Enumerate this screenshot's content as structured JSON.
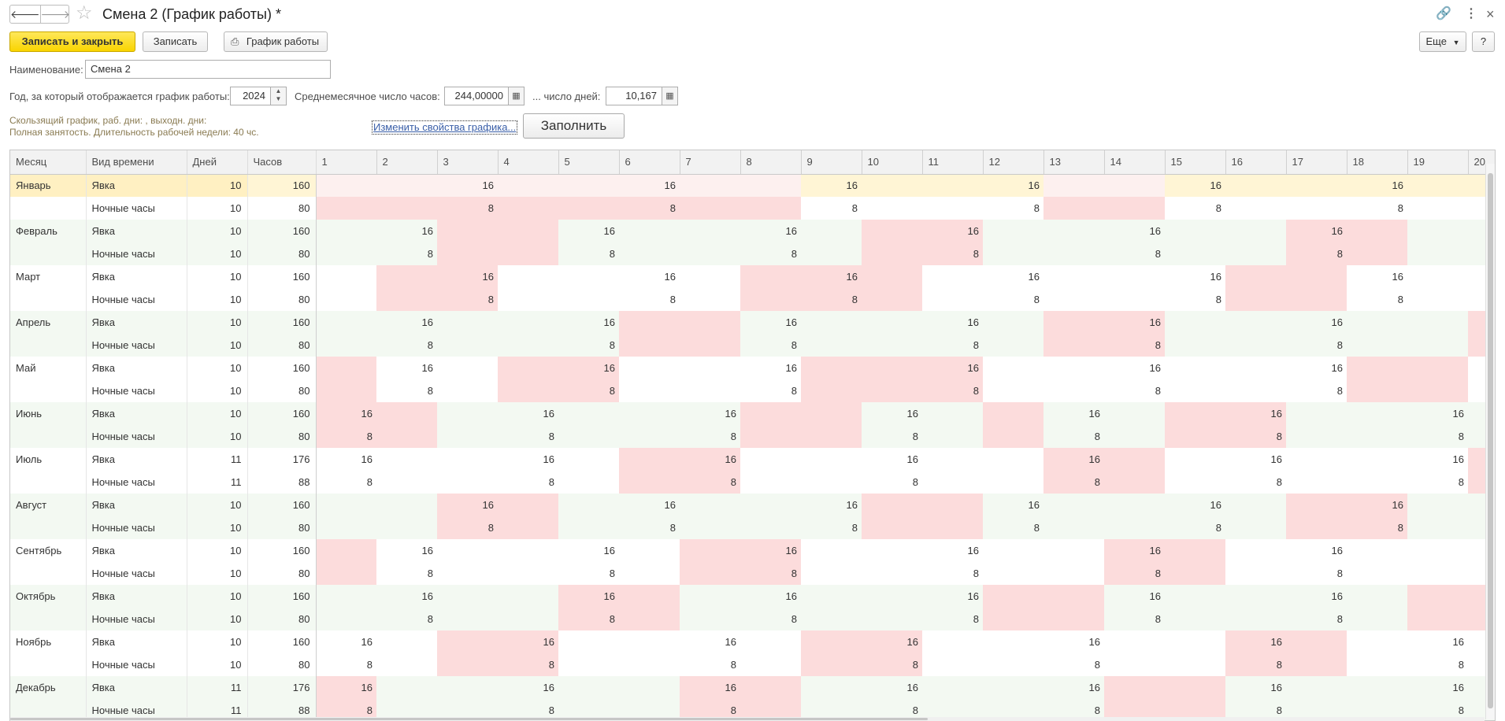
{
  "window": {
    "title": "Смена 2 (График работы) *",
    "back_icon": "arrow-left-icon",
    "forward_icon": "arrow-right-icon",
    "favorite_icon": "star-icon",
    "link_icon": "link-icon",
    "menu_icon": "kebab-menu-icon",
    "close_icon": "close-icon"
  },
  "toolbar": {
    "save_close_label": "Записать и закрыть",
    "save_label": "Записать",
    "schedule_label": "График работы",
    "more_label": "Еще",
    "help_label": "?"
  },
  "form": {
    "name_label": "Наименование:",
    "name_value": "Смена 2",
    "year_label": "Год, за который отображается график работы:",
    "year_value": "2024",
    "avg_hours_label": "Среднемесячное число часов:",
    "avg_hours_value": "244,00000",
    "avg_days_label": "... число дней:",
    "avg_days_value": "10,167",
    "hint_line1": "Скользящий график, раб. дни: , выходн. дни:",
    "hint_line2": "Полная занятость. Длительность рабочей недели: 40 чс.",
    "change_link": "Изменить свойства графика...",
    "fill_button": "Заполнить"
  },
  "colors": {
    "primary_button": "#f9d400",
    "weekend_cell": "#fcdcdc",
    "striped_row": "#f3f9f2",
    "selected_row": "#fff5d5"
  },
  "table": {
    "columns": [
      "Месяц",
      "Вид времени",
      "Дней",
      "Часов",
      "1",
      "2",
      "3",
      "4",
      "5",
      "6",
      "7",
      "8",
      "9",
      "10",
      "11",
      "12",
      "13",
      "14",
      "15",
      "16",
      "17",
      "18",
      "19",
      "20"
    ],
    "row_types": [
      "Явка",
      "Ночные часы"
    ],
    "months": [
      {
        "name": "Январь",
        "days": [
          10,
          10
        ],
        "hours": [
          160,
          80
        ],
        "work": [
          3,
          6,
          9,
          12,
          15,
          18
        ],
        "pink": [
          1,
          2,
          3,
          4,
          5,
          6,
          7,
          8,
          13,
          14
        ]
      },
      {
        "name": "Февраль",
        "days": [
          10,
          10
        ],
        "hours": [
          160,
          80
        ],
        "work": [
          2,
          5,
          8,
          11,
          14,
          17
        ],
        "pink": [
          3,
          4,
          10,
          11,
          17,
          18
        ]
      },
      {
        "name": "Март",
        "days": [
          10,
          10
        ],
        "hours": [
          160,
          80
        ],
        "work": [
          3,
          6,
          9,
          12,
          15,
          18
        ],
        "pink": [
          2,
          3,
          8,
          9,
          10,
          16,
          17
        ]
      },
      {
        "name": "Апрель",
        "days": [
          10,
          10
        ],
        "hours": [
          160,
          80
        ],
        "work": [
          2,
          5,
          8,
          11,
          14,
          17
        ],
        "pink": [
          6,
          7,
          13,
          14,
          20
        ]
      },
      {
        "name": "Май",
        "days": [
          10,
          10
        ],
        "hours": [
          160,
          80
        ],
        "work": [
          2,
          5,
          8,
          11,
          14,
          17
        ],
        "pink": [
          1,
          4,
          5,
          9,
          10,
          11,
          18,
          19
        ]
      },
      {
        "name": "Июнь",
        "days": [
          10,
          10
        ],
        "hours": [
          160,
          80
        ],
        "work": [
          1,
          4,
          7,
          10,
          13,
          16,
          19
        ],
        "pink": [
          1,
          2,
          8,
          9,
          12,
          15,
          16
        ]
      },
      {
        "name": "Июль",
        "days": [
          11,
          11
        ],
        "hours": [
          176,
          88
        ],
        "work": [
          1,
          4,
          7,
          10,
          13,
          16,
          19
        ],
        "pink": [
          6,
          7,
          13,
          14,
          20
        ]
      },
      {
        "name": "Август",
        "days": [
          10,
          10
        ],
        "hours": [
          160,
          80
        ],
        "work": [
          3,
          6,
          9,
          12,
          15,
          18
        ],
        "pink": [
          3,
          4,
          10,
          11,
          17,
          18
        ]
      },
      {
        "name": "Сентябрь",
        "days": [
          10,
          10
        ],
        "hours": [
          160,
          80
        ],
        "work": [
          2,
          5,
          8,
          11,
          14,
          17
        ],
        "pink": [
          1,
          7,
          8,
          14,
          15
        ]
      },
      {
        "name": "Октябрь",
        "days": [
          10,
          10
        ],
        "hours": [
          160,
          80
        ],
        "work": [
          2,
          5,
          8,
          11,
          14,
          17
        ],
        "pink": [
          5,
          6,
          12,
          13,
          19,
          20
        ]
      },
      {
        "name": "Ноябрь",
        "days": [
          10,
          10
        ],
        "hours": [
          160,
          80
        ],
        "work": [
          1,
          4,
          7,
          10,
          13,
          16,
          19
        ],
        "pink": [
          3,
          4,
          9,
          10,
          16,
          17
        ]
      },
      {
        "name": "Декабрь",
        "days": [
          11,
          11
        ],
        "hours": [
          176,
          88
        ],
        "work": [
          1,
          4,
          7,
          10,
          13,
          16,
          19
        ],
        "pink": [
          1,
          7,
          8,
          14,
          15
        ]
      }
    ],
    "work_value": "16",
    "night_value": "8"
  }
}
